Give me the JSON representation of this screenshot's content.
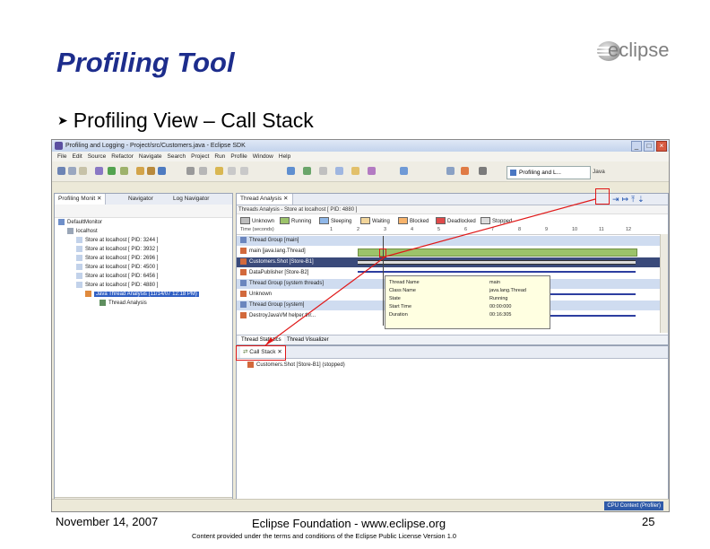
{
  "slide": {
    "title": "Profiling Tool",
    "bullet": "Profiling View – Call Stack",
    "logo_text": "eclipse",
    "footer_date": "November 14, 2007",
    "footer_center": "Eclipse Foundation - www.eclipse.org",
    "footer_license": "Content provided under the terms and conditions of the Eclipse Public License Version 1.0",
    "page_number": "25"
  },
  "window": {
    "title": "Profiling and Logging - Project/src/Customers.java - Eclipse SDK",
    "menu": [
      "File",
      "Edit",
      "Source",
      "Refactor",
      "Navigate",
      "Search",
      "Project",
      "Run",
      "Profile",
      "Window",
      "Help"
    ],
    "perspective_active": "Profiling and L...",
    "perspective_other": "Java"
  },
  "left_view": {
    "tabs": [
      "Profiling Monit",
      "Navigator",
      "Log Navigator"
    ],
    "tree": [
      {
        "label": "DefaultMonitor",
        "depth": 0
      },
      {
        "label": "localhost",
        "depth": 1
      },
      {
        "label": "Store at localhost [ PID: 3244 ]",
        "depth": 2
      },
      {
        "label": "Store at localhost [ PID: 3932 ]",
        "depth": 2
      },
      {
        "label": "Store at localhost [ PID: 2696 ]",
        "depth": 2
      },
      {
        "label": "Store at localhost [ PID: 4500 ]",
        "depth": 2
      },
      {
        "label": "Store at localhost [ PID: 6456 ]",
        "depth": 2
      },
      {
        "label": "Store at localhost [ PID: 4880 ]",
        "depth": 2
      },
      {
        "label": "Java Thread Analysis (11/14/07 12:18 PM)",
        "depth": 3,
        "selected": true
      },
      {
        "label": "Thread Analysis",
        "depth": 4
      }
    ]
  },
  "thread_view": {
    "tab": "Thread Analysis",
    "header": "Threads Analysis - Store at localhost [ PID: 4880 ]",
    "legend": [
      "Unknown",
      "Running",
      "Sleeping",
      "Waiting",
      "Blocked",
      "Deadlocked",
      "Stopped"
    ],
    "legend_colors": [
      "#bdbdbd",
      "#9cc36a",
      "#8fb7e8",
      "#f2d59a",
      "#f7b36b",
      "#e04a4a",
      "#dcdcdc"
    ],
    "scale_label": "Time (seconds)",
    "scale": [
      "1",
      "2",
      "3",
      "4",
      "5",
      "6",
      "7",
      "8",
      "9",
      "10",
      "11",
      "12"
    ],
    "rows": [
      {
        "label": "Thread Group [main]",
        "group": true
      },
      {
        "label": "main [java.lang.Thread]",
        "group": false
      },
      {
        "label": "Customers.Shot [Store-B1]",
        "group": false
      },
      {
        "label": "DataPublisher [Store-B2]",
        "group": false
      },
      {
        "label": "Thread Group [system threads]",
        "group": true
      },
      {
        "label": "Unknown",
        "group": false
      },
      {
        "label": "Thread Group [system]",
        "group": true
      },
      {
        "label": "DestroyJavaVM helper thr...",
        "group": false
      }
    ],
    "tooltip": [
      {
        "key": "Thread Name",
        "value": "main"
      },
      {
        "key": "Class Name",
        "value": "java.lang.Thread"
      },
      {
        "key": "State",
        "value": "Running"
      },
      {
        "key": "Start Time",
        "value": "00:00:000"
      },
      {
        "key": "Duration",
        "value": "00:16:305"
      }
    ],
    "bottom_tabs": [
      "Thread Statistics",
      "Thread Visualizer"
    ]
  },
  "callstack_view": {
    "tab": "Call Stack",
    "entry": "Customers.Shot [Store-B1] (stopped)"
  },
  "status": {
    "badge": "CPU Context (Profiler)"
  }
}
